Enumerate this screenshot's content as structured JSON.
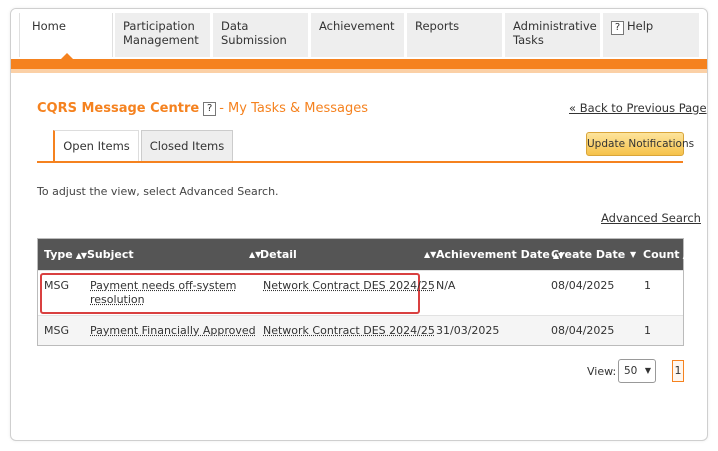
{
  "nav": {
    "home": "Home",
    "participation": "Participation Management",
    "data_submission": "Data Submission",
    "achievement": "Achievement",
    "reports": "Reports",
    "admin": "Administrative Tasks",
    "help": "Help"
  },
  "page": {
    "title": "CQRS Message Centre",
    "help_glyph": "?",
    "subtitle": "- My Tasks & Messages",
    "back_link": "« Back to Previous Page"
  },
  "tabs": {
    "open": "Open Items",
    "closed": "Closed Items"
  },
  "update_button": "Update Notifications",
  "hint": "To adjust the view, select Advanced Search.",
  "advanced_search": "Advanced Search",
  "table": {
    "headers": {
      "type": "Type",
      "subject": "Subject",
      "detail": "Detail",
      "achievement_date": "Achievement Date",
      "create_date": "Create Date",
      "count": "Count"
    },
    "rows": [
      {
        "type": "MSG",
        "subject": "Payment needs off-system resolution",
        "detail": "Network Contract DES 2024/25",
        "achievement_date": "N/A",
        "create_date": "08/04/2025",
        "count": "1"
      },
      {
        "type": "MSG",
        "subject": "Payment Financially Approved",
        "detail": "Network Contract DES 2024/25",
        "achievement_date": "31/03/2025",
        "create_date": "08/04/2025",
        "count": "1"
      }
    ]
  },
  "pager": {
    "view_label": "View:",
    "view_value": "50",
    "page": "1"
  },
  "colors": {
    "accent": "#f5821f",
    "header_bg": "#555555",
    "highlight": "#d94040"
  }
}
